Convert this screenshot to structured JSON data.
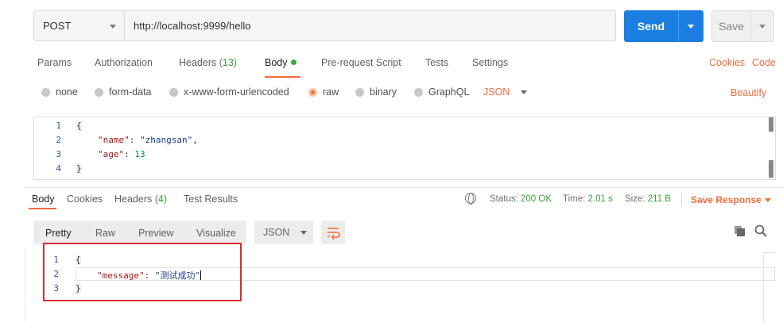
{
  "request": {
    "method": "POST",
    "url": "http://localhost:9999/hello",
    "send_label": "Send",
    "save_label": "Save"
  },
  "request_tabs": {
    "params": "Params",
    "authorization": "Authorization",
    "headers": "Headers",
    "headers_count": "(13)",
    "body": "Body",
    "prerequest": "Pre-request Script",
    "tests": "Tests",
    "settings": "Settings",
    "cookies": "Cookies",
    "code": "Code"
  },
  "body_types": {
    "none": "none",
    "form_data": "form-data",
    "urlencoded": "x-www-form-urlencoded",
    "raw": "raw",
    "binary": "binary",
    "graphql": "GraphQL",
    "format": "JSON",
    "beautify": "Beautify",
    "selected": "raw"
  },
  "request_body": {
    "line_numbers": [
      "1",
      "2",
      "3",
      "4"
    ],
    "open_brace": "{",
    "name_key": "\"name\"",
    "name_value": "\"zhangsan\"",
    "age_key": "\"age\"",
    "age_value": "13",
    "close_brace": "}"
  },
  "response_tabs": {
    "body": "Body",
    "cookies": "Cookies",
    "headers": "Headers",
    "headers_count": "(4)",
    "test_results": "Test Results"
  },
  "response_status": {
    "status_label": "Status:",
    "status_value": "200 OK",
    "time_label": "Time:",
    "time_value": "2.01 s",
    "size_label": "Size:",
    "size_value": "211 B",
    "save_response": "Save Response"
  },
  "response_view": {
    "pretty": "Pretty",
    "raw": "Raw",
    "preview": "Preview",
    "visualize": "Visualize",
    "format": "JSON"
  },
  "response_body": {
    "line_numbers": [
      "1",
      "2",
      "3"
    ],
    "open_brace": "{",
    "message_key": "\"message\"",
    "message_value": "\"测试成功\"",
    "close_brace": "}"
  },
  "colors": {
    "accent": "#f26b3a",
    "send_button": "#1a7fe0",
    "success": "#3a9b3a",
    "annotation_box": "#d32f2f"
  }
}
